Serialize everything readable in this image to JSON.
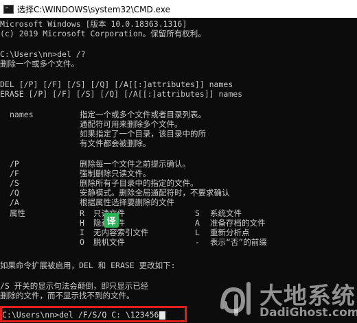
{
  "window": {
    "title": "选择C:\\WINDOWS\\system32\\CMD.exe"
  },
  "console": {
    "header": [
      "Microsoft Windows [版本 10.0.18363.1316]",
      "(c) 2019 Microsoft Corporation。保留所有权利。"
    ],
    "prompt1": "C:\\Users\\nn>del /?",
    "description": "删除一个或多个文件。",
    "syntax": [
      "DEL [/P] [/F] [/S] [/Q] [/A[[:]attributes]] names",
      "ERASE [/P] [/F] [/S] [/Q] [/A[[:]attributes]] names"
    ],
    "names_label": "names",
    "names_desc": [
      "指定一个或多个文件或者目录列表。",
      "通配符可用来删除多个文件。",
      "如果指定了一个目录，该目录中的所",
      "有文件都会被删除。"
    ],
    "switches": [
      {
        "flag": "/P",
        "desc": "删除每一个文件之前提示确认。"
      },
      {
        "flag": "/F",
        "desc": "强制删除只读文件。"
      },
      {
        "flag": "/S",
        "desc": "删除所有子目录中的指定的文件。"
      },
      {
        "flag": "/Q",
        "desc": "安静模式。删除全局通配符时，不要求确认"
      },
      {
        "flag": "/A",
        "desc": "根据属性选择要删除的文件"
      }
    ],
    "attributes_label": "属性",
    "attributes": [
      {
        "k1": "R",
        "v1": "只读文件",
        "k2": "S",
        "v2": "系统文件"
      },
      {
        "k1": "H",
        "v1": "隐藏文件",
        "k2": "A",
        "v2": "准备存档的文件"
      },
      {
        "k1": "I",
        "v1": "无内容索引文件",
        "k2": "L",
        "v2": "重新分析点"
      },
      {
        "k1": "O",
        "v1": "脱机文件",
        "k2": "-",
        "v2": "表示“否”的前缀"
      }
    ],
    "extensions": "如果命令扩展被启用，DEL 和 ERASE 更改如下:",
    "display_note": [
      "/S 开关的显示句法会颠倒，即只显示已经",
      "删除的文件，而不显示找不到的文件。"
    ],
    "current_command": "C:\\Users\\nn>del /F/S/Q C: \\123456"
  },
  "overlay": {
    "translate_badge": "译",
    "watermark_main": "大地系统",
    "watermark_sub": "DadiGhost.com"
  },
  "colors": {
    "background": "#0c0c0c",
    "text": "#cccccc",
    "highlight_border": "#e02020",
    "badge": "#2fb35a"
  }
}
